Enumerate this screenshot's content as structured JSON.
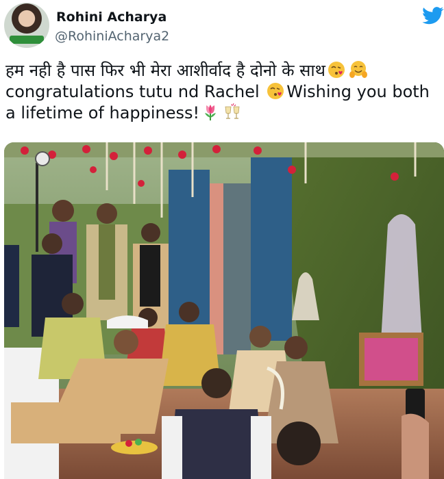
{
  "author": {
    "name": "Rohini Acharya",
    "handle": "@RohiniAcharya2"
  },
  "tweet": {
    "line1": "हम नही है पास फिर भी मेरा आशीर्वाद है दोनो के साथ",
    "line2_a": "congratulations tutu nd Rachel ",
    "line2_b": "Wishing you both",
    "line3": "a lifetime of happiness!"
  },
  "icons": {
    "platform": "twitter-bird-icon",
    "emoji_1": "face-blowing-kiss-icon",
    "emoji_2": "hugging-face-icon",
    "emoji_3": "face-blowing-kiss-icon",
    "emoji_4": "tulip-icon",
    "emoji_5": "clinking-glasses-icon"
  },
  "colors": {
    "twitter_blue": "#1d9bf0",
    "handle_gray": "#536471"
  },
  "media": {
    "description_icon": "wedding-photo"
  }
}
